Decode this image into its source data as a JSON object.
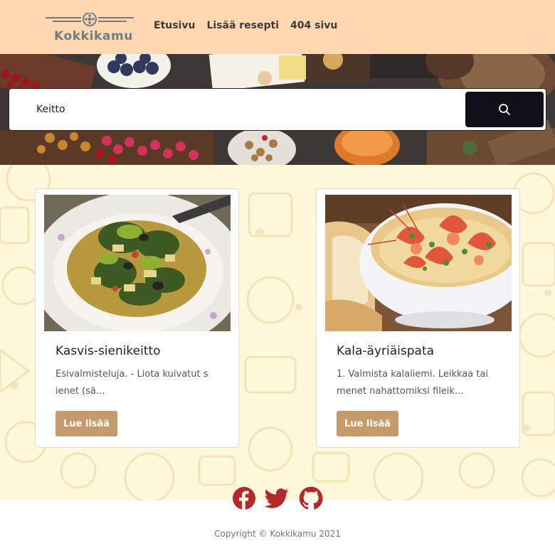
{
  "brand": {
    "name": "Kokkikamu"
  },
  "nav": {
    "links": [
      {
        "label": "Etusivu"
      },
      {
        "label": "Lisää resepti"
      },
      {
        "label": "404 sivu"
      }
    ]
  },
  "search": {
    "value": "Keitto",
    "button_icon": "search-icon"
  },
  "recipes": [
    {
      "title": "Kasvis-sienikeitto",
      "excerpt": "Esivalmisteluja. - Liota kuivatut s ienet (sä...",
      "button": "Lue lisää",
      "image": "soup-plate-photo"
    },
    {
      "title": "Kala-äyriäispata",
      "excerpt": "1. Valmista kalaliemi. Leikkaa tai menet nahattomiksi fileik...",
      "button": "Lue lisää",
      "image": "seafood-stew-photo"
    }
  ],
  "social": [
    {
      "icon": "facebook-icon"
    },
    {
      "icon": "twitter-icon"
    },
    {
      "icon": "github-icon"
    }
  ],
  "footer": {
    "copyright": "Copyright  © Kokkikamu 2021"
  },
  "colors": {
    "nav_bg": "#ffd8b1",
    "main_bg": "#fff8da",
    "button": "#c59a6d",
    "search_button": "#0d1117",
    "social": "#b5282c"
  }
}
